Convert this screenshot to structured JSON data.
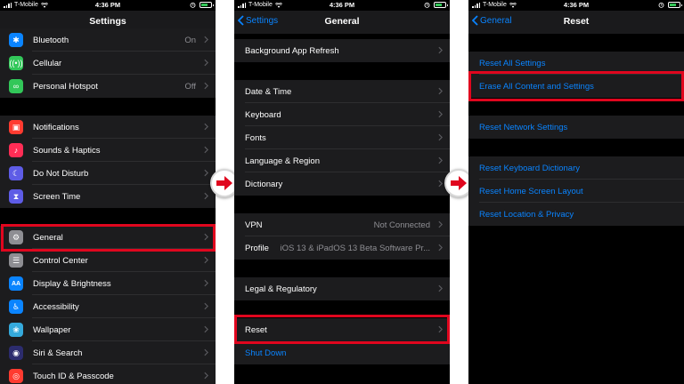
{
  "status_bar": {
    "carrier": "T-Mobile",
    "time": "4:36 PM",
    "battery_color": "#35c759"
  },
  "colors": {
    "accent": "#0a84ff",
    "highlight": "#e0061e",
    "arrow": "#e0061e"
  },
  "screen_settings": {
    "title": "Settings",
    "rows": [
      {
        "label": "Bluetooth",
        "value": "On",
        "icon": "bluetooth-icon",
        "icon_bg": "#0a84ff"
      },
      {
        "label": "Cellular",
        "value": "",
        "icon": "cellular-icon",
        "icon_bg": "#32c759"
      },
      {
        "label": "Personal Hotspot",
        "value": "Off",
        "icon": "hotspot-icon",
        "icon_bg": "#32c759"
      },
      {
        "label": "Notifications",
        "value": "",
        "icon": "notifications-icon",
        "icon_bg": "#ff3b30"
      },
      {
        "label": "Sounds & Haptics",
        "value": "",
        "icon": "sounds-icon",
        "icon_bg": "#ff2d55"
      },
      {
        "label": "Do Not Disturb",
        "value": "",
        "icon": "moon-icon",
        "icon_bg": "#5e5ce6"
      },
      {
        "label": "Screen Time",
        "value": "",
        "icon": "hourglass-icon",
        "icon_bg": "#5e5ce6"
      },
      {
        "label": "General",
        "value": "",
        "icon": "gear-icon",
        "icon_bg": "#8e8e93"
      },
      {
        "label": "Control Center",
        "value": "",
        "icon": "control-center-icon",
        "icon_bg": "#8e8e93"
      },
      {
        "label": "Display & Brightness",
        "value": "",
        "icon": "display-icon",
        "icon_bg": "#0a84ff"
      },
      {
        "label": "Accessibility",
        "value": "",
        "icon": "accessibility-icon",
        "icon_bg": "#0a84ff"
      },
      {
        "label": "Wallpaper",
        "value": "",
        "icon": "wallpaper-icon",
        "icon_bg": "#35aadc"
      },
      {
        "label": "Siri & Search",
        "value": "",
        "icon": "siri-icon",
        "icon_bg": "#2c2c6e"
      },
      {
        "label": "Touch ID & Passcode",
        "value": "",
        "icon": "fingerprint-icon",
        "icon_bg": "#ff3b30"
      }
    ]
  },
  "screen_general": {
    "title": "General",
    "back": "Settings",
    "rows": [
      {
        "label": "Background App Refresh",
        "value": ""
      },
      {
        "label": "Date & Time",
        "value": ""
      },
      {
        "label": "Keyboard",
        "value": ""
      },
      {
        "label": "Fonts",
        "value": ""
      },
      {
        "label": "Language & Region",
        "value": ""
      },
      {
        "label": "Dictionary",
        "value": ""
      },
      {
        "label": "VPN",
        "value": "Not Connected"
      },
      {
        "label": "Profile",
        "value": "iOS 13 & iPadOS 13 Beta Software Pr..."
      },
      {
        "label": "Legal & Regulatory",
        "value": ""
      },
      {
        "label": "Reset",
        "value": ""
      },
      {
        "label": "Shut Down",
        "value": ""
      }
    ]
  },
  "screen_reset": {
    "title": "Reset",
    "back": "General",
    "rows": [
      {
        "label": "Reset All Settings"
      },
      {
        "label": "Erase All Content and Settings"
      },
      {
        "label": "Reset Network Settings"
      },
      {
        "label": "Reset Keyboard Dictionary"
      },
      {
        "label": "Reset Home Screen Layout"
      },
      {
        "label": "Reset Location & Privacy"
      }
    ]
  }
}
